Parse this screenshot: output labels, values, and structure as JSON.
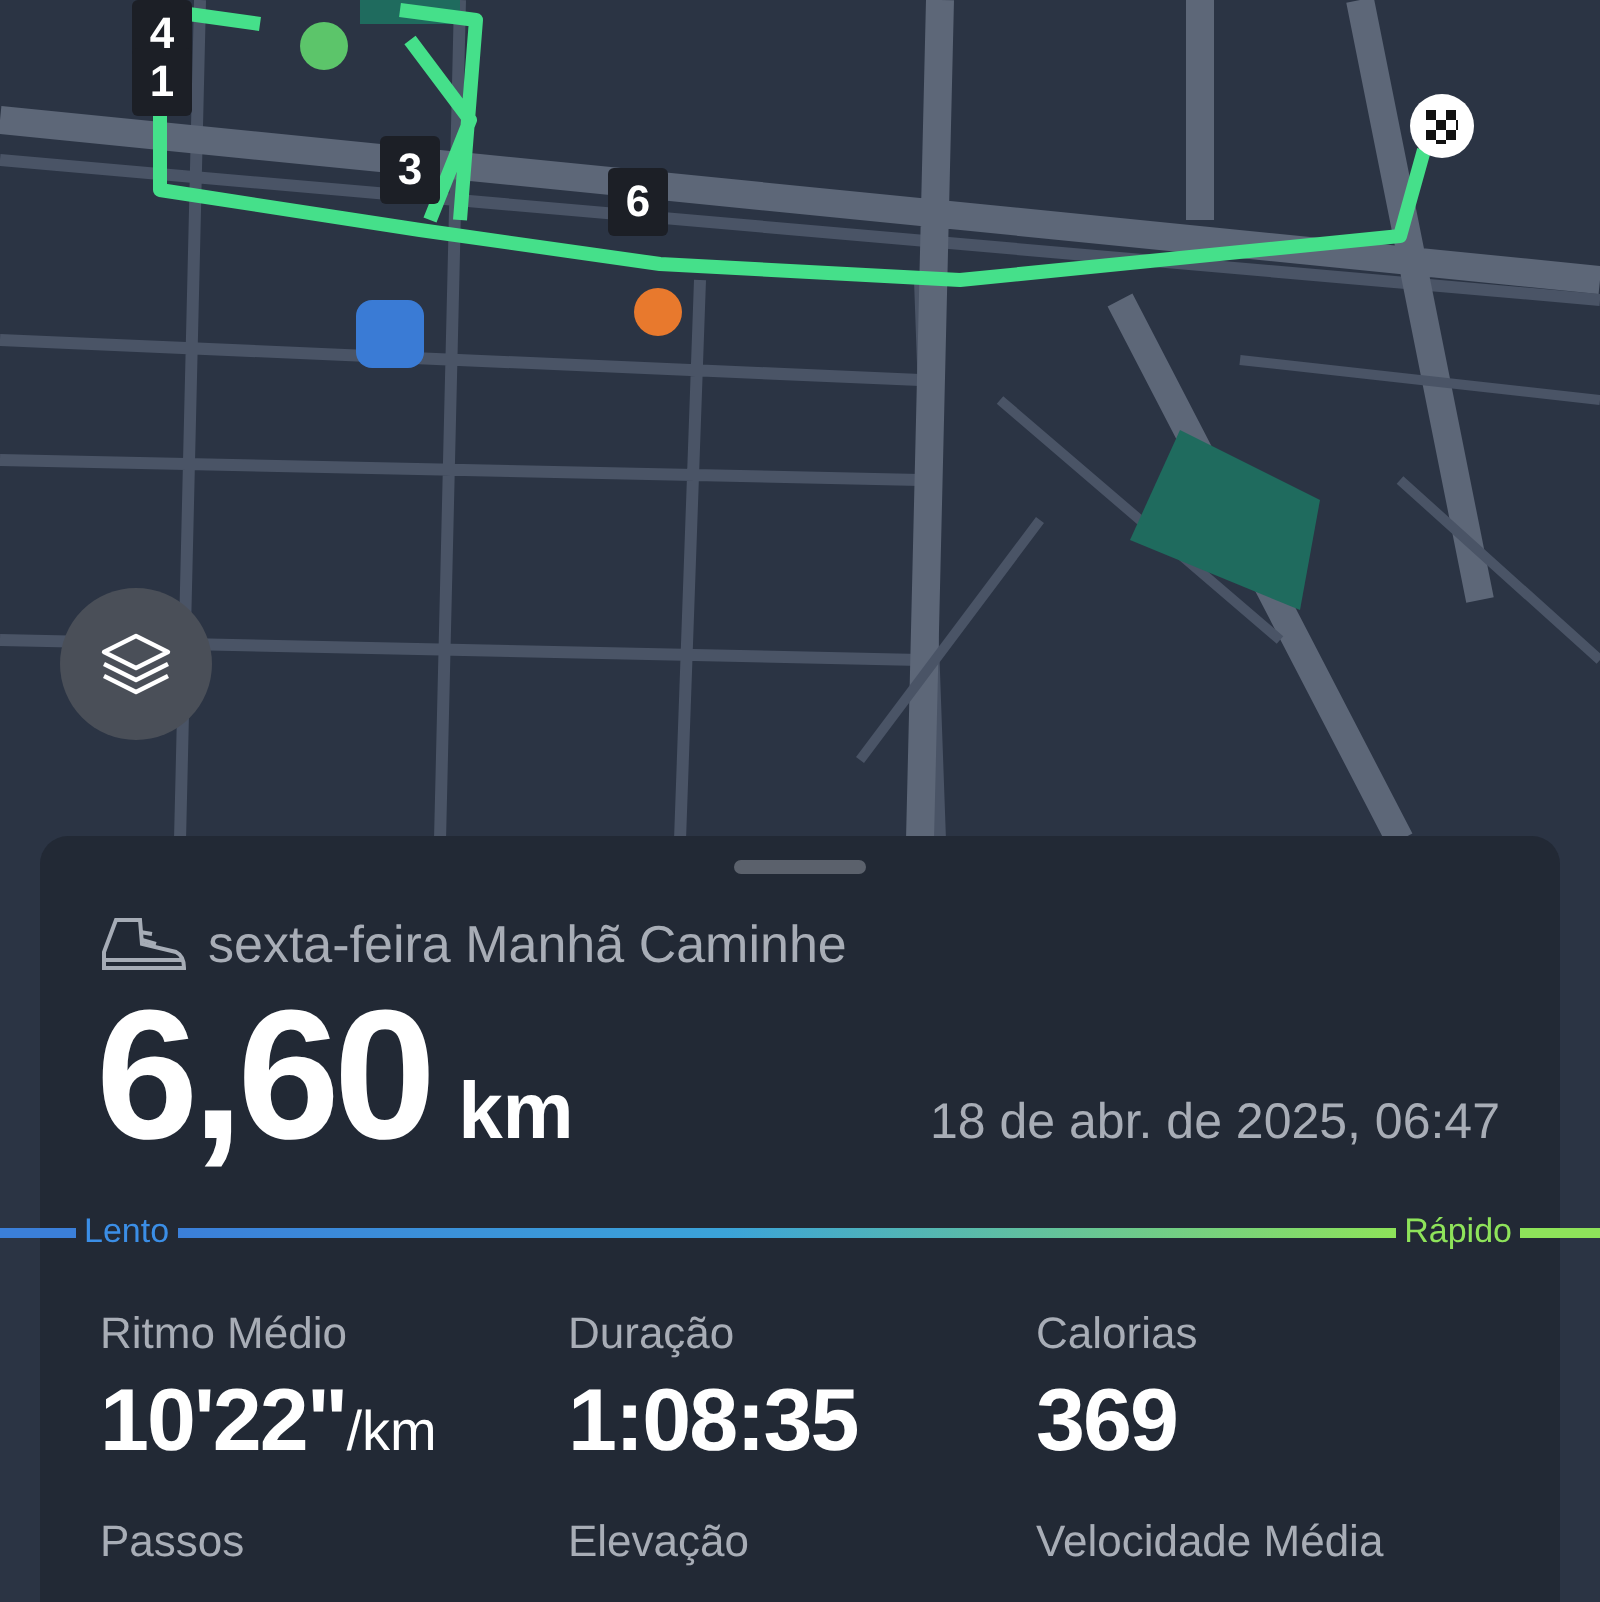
{
  "map": {
    "route_markers": [
      {
        "label": "4"
      },
      {
        "label": "1"
      },
      {
        "label": "3"
      },
      {
        "label": "6"
      }
    ]
  },
  "activity": {
    "title": "sexta-feira Manhã Caminhe",
    "distance": "6,60",
    "distance_unit": "km",
    "date": "18 de abr. de 2025, 06:47",
    "pace_scale": {
      "slow": "Lento",
      "fast": "Rápido"
    },
    "stats": [
      {
        "label": "Ritmo Médio",
        "value": "10'22\"",
        "unit": "/km"
      },
      {
        "label": "Duração",
        "value": "1:08:35"
      },
      {
        "label": "Calorias",
        "value": "369"
      },
      {
        "label": "Passos"
      },
      {
        "label": "Elevação"
      },
      {
        "label": "Velocidade Média"
      }
    ]
  }
}
